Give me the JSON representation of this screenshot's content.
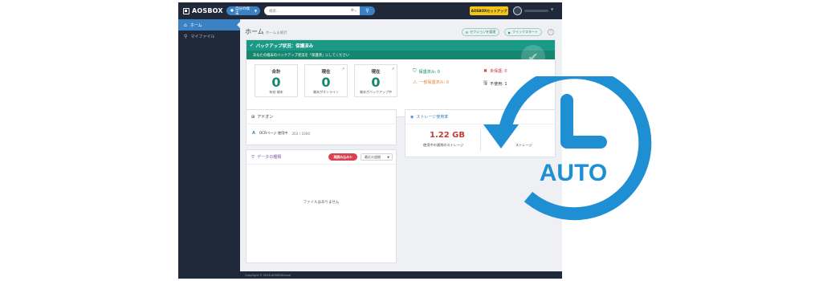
{
  "brand": "AOSBOX",
  "topbar": {
    "user_select_label": "自分の端末",
    "search_placeholder": "検索...",
    "setup_button": "AOSBOXセットアップ"
  },
  "sidebar": {
    "items": [
      {
        "label": "ホーム",
        "icon": "home-icon",
        "active": true
      },
      {
        "label": "マイファイル",
        "icon": "search-icon",
        "active": false
      }
    ]
  },
  "page": {
    "title": "ホーム",
    "subtitle": "ホーム＆統計",
    "btn_section": "セクションを管理",
    "btn_quick": "クイックスタート"
  },
  "backup": {
    "header": "バックアップ状況：保護済み",
    "message": "あなたの端末のバックアップ状況を「保護済」にしてください",
    "stats": [
      {
        "title": "合計",
        "value": "0",
        "label": "有効 端末"
      },
      {
        "title": "現在",
        "value": "0",
        "label": "端末がオンライン"
      },
      {
        "title": "現在",
        "value": "0",
        "label": "端末がバックアップ中"
      }
    ],
    "protection": {
      "protected": "保護済み: 0",
      "unprotected": "未保護: 0",
      "partial": "一部保護済み: 0",
      "unused": "不使用: 1"
    },
    "colors": {
      "header": "#1a9a86",
      "protected": "#17866f",
      "unprotected": "#c43a3a",
      "partial": "#e0893a"
    }
  },
  "addon": {
    "title": "アドオン",
    "row_name": "OCRページ 使用中",
    "row_count": "202 / 1000"
  },
  "storage": {
    "title": "ストレージ使用率",
    "value": "1.22 GB",
    "label": "使用中の通常のストレージ",
    "label2": "ストレージ"
  },
  "data": {
    "title": "データの種類",
    "reread_button": "再読み込み",
    "sort_label": "最近の週間",
    "empty_message": "ファイルはありません"
  },
  "footer": "Copyright © 2018 AOSBOXcloud",
  "auto_icon": {
    "text": "AUTO",
    "color": "#1f8fd4"
  }
}
